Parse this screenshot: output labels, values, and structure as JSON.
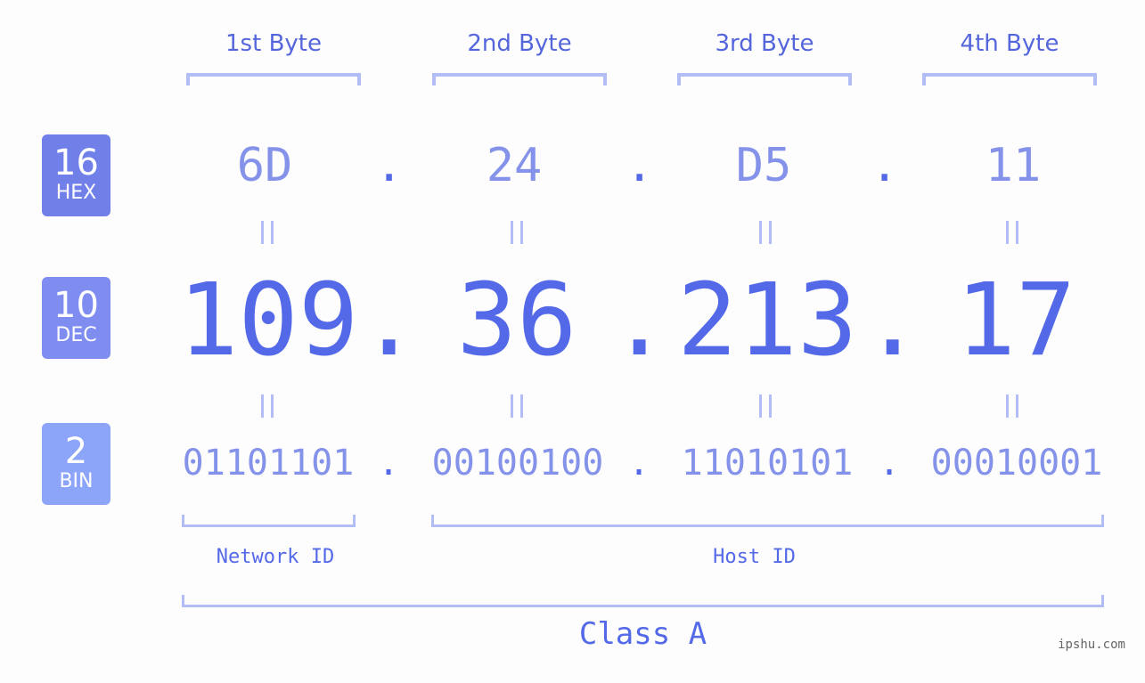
{
  "ip": {
    "dotted_decimal": "109.36.213.17",
    "class": "Class A"
  },
  "byte_headers": [
    "1st Byte",
    "2nd Byte",
    "3rd Byte",
    "4th Byte"
  ],
  "bases": [
    {
      "num": "16",
      "name": "HEX",
      "color": "#7180e8"
    },
    {
      "num": "10",
      "name": "DEC",
      "color": "#7f8cf0"
    },
    {
      "num": "2",
      "name": "BIN",
      "color": "#8da5f8"
    }
  ],
  "rows": {
    "hex": [
      "6D",
      "24",
      "D5",
      "11"
    ],
    "dec": [
      "109",
      "36",
      "213",
      "17"
    ],
    "bin": [
      "01101101",
      "00100100",
      "11010101",
      "00010001"
    ]
  },
  "separator": ".",
  "segments": {
    "network_label": "Network ID",
    "host_label": "Host ID",
    "class_label": "Class A"
  },
  "watermark": "ipshu.com",
  "colors": {
    "accent": "#5469e8",
    "light_text": "#8592ea",
    "bracket": "#b3bdf5",
    "background": "#fcfdfc"
  }
}
